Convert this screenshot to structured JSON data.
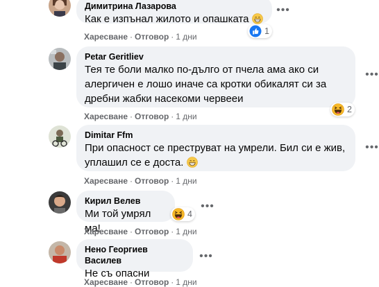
{
  "comments": [
    {
      "author": "Димитрина Лазарова",
      "text": "Как е изпънал жилото и опашката",
      "like_label": "Харесване",
      "reply_label": "Отговор",
      "age": "1 дни",
      "reaction_icon": "like-icon",
      "reaction_count": "1"
    },
    {
      "author": "Petar Geritliev",
      "text_lines": [
        "Тея те боли малко по-дълго от пчела ама ако си",
        "алергичен е лошо иначе са кротки обикалят си за",
        "дребни жабки насекоми червееи"
      ],
      "like_label": "Харесване",
      "reply_label": "Отговор",
      "age": "1 дни",
      "reaction_icon": "haha-icon",
      "reaction_count": "2"
    },
    {
      "author": "Dimitar Ffm",
      "text_lines": [
        "При опасност се преструват на умрели. Бил си е жив,",
        "уплашил се е доста."
      ],
      "like_label": "Харесване",
      "reply_label": "Отговор",
      "age": "1 дни"
    },
    {
      "author": "Кирил Велев",
      "text": "Ми той умрял ма!",
      "like_label": "Харесване",
      "reply_label": "Отговор",
      "age": "1 дни",
      "reaction_icon": "haha-icon",
      "reaction_count": "4"
    },
    {
      "author": "Нено Георгиев Василев",
      "text": "Не съ опасни",
      "like_label": "Харесване",
      "reply_label": "Отговор",
      "age": "1 дни"
    }
  ],
  "separator": "·",
  "more_glyph": "•••",
  "colors": {
    "bubble": "#f0f2f5",
    "meta": "#65676b",
    "like_blue": "#1877f2",
    "haha_yellow": "#f7b928"
  }
}
